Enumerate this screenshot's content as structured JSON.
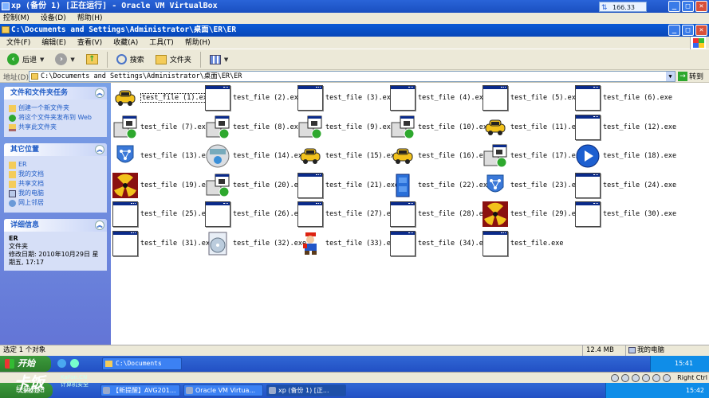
{
  "vbox": {
    "title": "xp (备份 1) [正在运行] - Oracle VM VirtualBox",
    "net_popup": "166.33 KB/s",
    "menu": [
      "控制(M)",
      "设备(D)",
      "帮助(H)"
    ],
    "buttons": {
      "min": "_",
      "max": "□",
      "close": "✕"
    }
  },
  "explorer": {
    "title": "C:\\Documents and Settings\\Administrator\\桌面\\ER\\ER",
    "menu": [
      "文件(F)",
      "编辑(E)",
      "查看(V)",
      "收藏(A)",
      "工具(T)",
      "帮助(H)"
    ],
    "toolbar": {
      "back": "后退",
      "search": "搜索",
      "folders": "文件夹"
    },
    "address_label": "地址(D)",
    "address": "C:\\Documents and Settings\\Administrator\\桌面\\ER\\ER",
    "go": "转到"
  },
  "left": {
    "tasks": {
      "title": "文件和文件夹任务",
      "items": [
        "创建一个新文件夹",
        "将这个文件夹发布到 Web",
        "共享此文件夹"
      ]
    },
    "places": {
      "title": "其它位置",
      "items": [
        "ER",
        "我的文档",
        "共享文档",
        "我的电脑",
        "网上邻居"
      ]
    },
    "details": {
      "title": "详细信息",
      "name": "ER",
      "type": "文件夹",
      "modified": "修改日期: 2010年10月29日 星期五, 17:17"
    }
  },
  "files": [
    {
      "name": "test_file (1).exe",
      "icon": "taxi-icon"
    },
    {
      "name": "test_file (2).exe",
      "icon": "app-window-icon"
    },
    {
      "name": "test_file (3).exe",
      "icon": "app-window-icon"
    },
    {
      "name": "test_file (4).exe",
      "icon": "app-window-icon"
    },
    {
      "name": "test_file (5).exe",
      "icon": "app-window-icon"
    },
    {
      "name": "test_file (6).exe",
      "icon": "app-window-icon"
    },
    {
      "name": "test_file (7).exe",
      "icon": "installer-icon"
    },
    {
      "name": "test_file (8).exe",
      "icon": "installer-icon"
    },
    {
      "name": "test_file (9).exe",
      "icon": "installer-icon"
    },
    {
      "name": "test_file (10).exe",
      "icon": "installer-icon"
    },
    {
      "name": "test_file (11).exe",
      "icon": "taxi-icon"
    },
    {
      "name": "test_file (12).exe",
      "icon": "app-window-icon"
    },
    {
      "name": "test_file (13).exe",
      "icon": "network-shield-icon"
    },
    {
      "name": "test_file (14).exe",
      "icon": "wizard-cd-icon"
    },
    {
      "name": "test_file (15).exe",
      "icon": "taxi-icon"
    },
    {
      "name": "test_file (16).exe",
      "icon": "taxi-icon"
    },
    {
      "name": "test_file (17).exe",
      "icon": "installer-icon"
    },
    {
      "name": "test_file (18).exe",
      "icon": "media-player-icon"
    },
    {
      "name": "test_file (19).exe",
      "icon": "radiation-icon"
    },
    {
      "name": "test_file (20).exe",
      "icon": "installer-icon"
    },
    {
      "name": "test_file (21).exe",
      "icon": "app-window-icon"
    },
    {
      "name": "test_file (22).exe",
      "icon": "cabinet-icon"
    },
    {
      "name": "test_file (23).exe",
      "icon": "network-shield-icon"
    },
    {
      "name": "test_file (24).exe",
      "icon": "app-window-icon"
    },
    {
      "name": "test_file (25).exe",
      "icon": "app-window-icon"
    },
    {
      "name": "test_file (26).exe",
      "icon": "app-window-icon"
    },
    {
      "name": "test_file (27).exe",
      "icon": "app-window-icon"
    },
    {
      "name": "test_file (28).exe",
      "icon": "app-window-icon"
    },
    {
      "name": "test_file (29).exe",
      "icon": "radiation-icon"
    },
    {
      "name": "test_file (30).exe",
      "icon": "app-window-icon"
    },
    {
      "name": "test_file (31).exe",
      "icon": "app-window-icon"
    },
    {
      "name": "test_file (32).exe",
      "icon": "disc-setup-icon"
    },
    {
      "name": "test_file (33).exe",
      "icon": "mario-icon"
    },
    {
      "name": "test_file (34).exe",
      "icon": "app-window-icon"
    },
    {
      "name": "test_file.exe",
      "icon": "app-window-icon"
    }
  ],
  "status": {
    "selection": "选定 1 个对象",
    "size": "12.4 MB",
    "location": "我的电脑"
  },
  "guest_taskbar": {
    "start": "开始",
    "task": "C:\\Documents and...",
    "clock": "15:41"
  },
  "vbox_status": {
    "host_key": "Right Ctrl"
  },
  "host_taskbar": {
    "start": "经典开始",
    "tasks": [
      "【新提醒】AVG201...",
      "Oracle VM Virtua...",
      "xp (备份 1) [正..."
    ],
    "clock": "15:42"
  },
  "watermark": {
    "brand": "卡饭",
    "site": "KaFan.CN",
    "sub": "计算机安全",
    "tagline": "大家都是"
  }
}
